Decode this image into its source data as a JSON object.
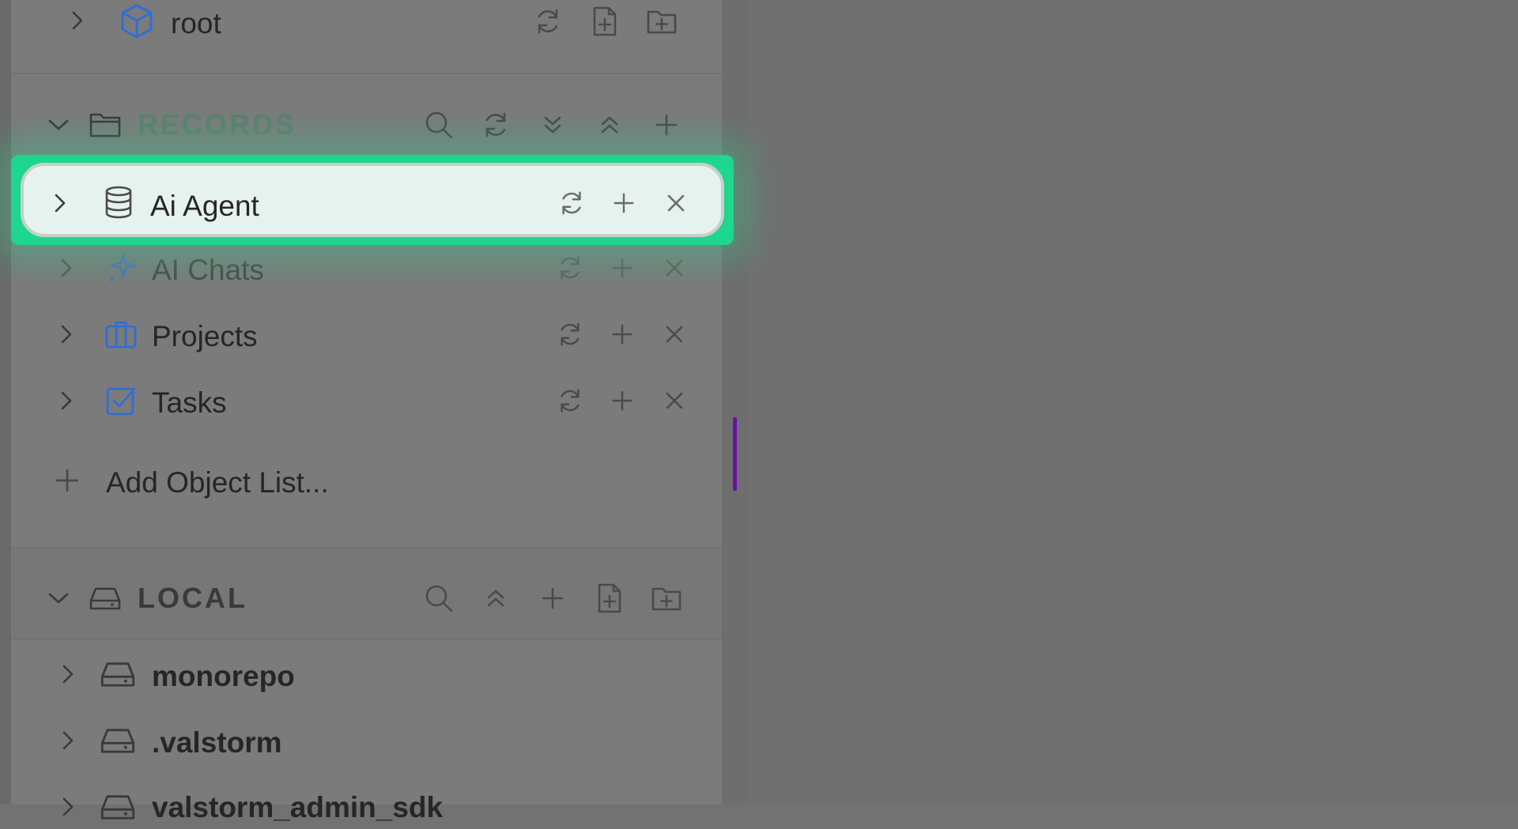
{
  "top_row": {
    "label": "root"
  },
  "records": {
    "header": "RECORDS",
    "items": [
      {
        "label": "Ai Agent",
        "icon": "database-icon"
      },
      {
        "label": "AI Chats",
        "icon": "sparkles-icon"
      },
      {
        "label": "Projects",
        "icon": "briefcase-icon"
      },
      {
        "label": "Tasks",
        "icon": "checkbox-icon"
      }
    ],
    "add_label": "Add Object List..."
  },
  "local": {
    "header": "LOCAL",
    "items": [
      {
        "label": "monorepo",
        "icon": "drive-icon"
      },
      {
        "label": ".valstorm",
        "icon": "drive-icon"
      },
      {
        "label": "valstorm_admin_sdk",
        "icon": "drive-icon"
      }
    ]
  },
  "colors": {
    "highlight": "#1fd68f",
    "accent_icon": "#2f6fd6",
    "splitter_accent": "#6a12a6"
  }
}
